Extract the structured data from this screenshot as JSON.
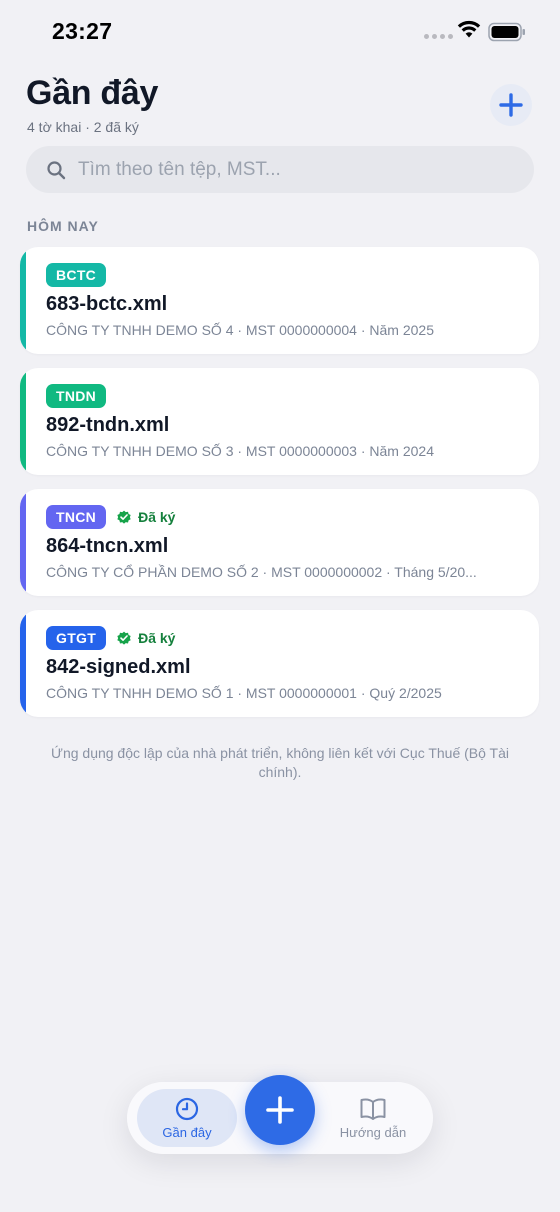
{
  "status_bar": {
    "time": "23:27"
  },
  "header": {
    "title": "Gần đây",
    "subtitle": "4 tờ khai · 2 đã ký"
  },
  "search": {
    "placeholder": "Tìm theo tên tệp, MST..."
  },
  "section": {
    "label": "HÔM NAY"
  },
  "items": [
    {
      "type": "BCTC",
      "color": "#14b8a6",
      "signed": false,
      "signed_label": "",
      "filename": "683-bctc.xml",
      "meta": "CÔNG TY TNHH DEMO SỐ 4 · MST 0000000004 · Năm 2025"
    },
    {
      "type": "TNDN",
      "color": "#10b981",
      "signed": false,
      "signed_label": "",
      "filename": "892-tndn.xml",
      "meta": "CÔNG TY TNHH DEMO SỐ 3 · MST 0000000003 · Năm 2024"
    },
    {
      "type": "TNCN",
      "color": "#6366f1",
      "signed": true,
      "signed_label": "Đã ký",
      "filename": "864-tncn.xml",
      "meta": "CÔNG TY CỔ PHẦN DEMO SỐ 2 · MST 0000000002 · Tháng 5/20..."
    },
    {
      "type": "GTGT",
      "color": "#2563eb",
      "signed": true,
      "signed_label": "Đã ký",
      "filename": "842-signed.xml",
      "meta": "CÔNG TY TNHH DEMO SỐ 1 · MST 0000000001 · Quý 2/2025"
    }
  ],
  "disclaimer": "Ứng dụng độc lập của nhà phát triển, không liên kết với Cục Thuế (Bộ Tài chính).",
  "tabbar": {
    "recent_label": "Gần đây",
    "guide_label": "Hướng dẫn",
    "recent_icon": "clock-icon",
    "add_icon": "plus-icon",
    "guide_icon": "book-icon"
  },
  "colors": {
    "accent": "#2e6be6",
    "signed": "#15803d",
    "background": "#f1f1f5"
  }
}
